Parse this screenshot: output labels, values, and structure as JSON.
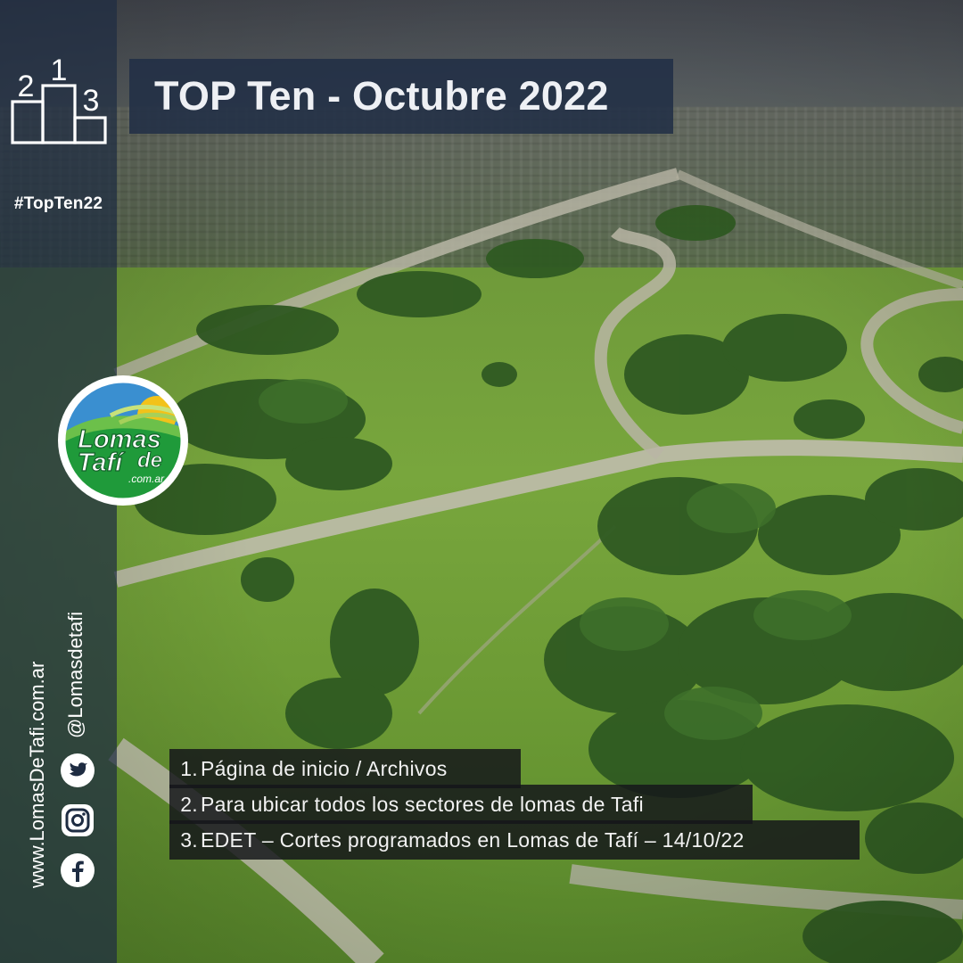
{
  "header": {
    "title": "TOP Ten - Octubre 2022",
    "hashtag": "#TopTen22"
  },
  "podium": {
    "icon": "podium-icon",
    "place_1": "1",
    "place_2": "2",
    "place_3": "3"
  },
  "logo": {
    "icon": "lomas-de-tafi-logo",
    "line1": "Lomas",
    "line2": "Tafí",
    "line2_suffix": "de",
    "domain": ".com.ar"
  },
  "contact": {
    "website": "www.LomasDeTafi.com.ar",
    "handle": "@Lomasdetafi",
    "social_icons": [
      "twitter-icon",
      "instagram-icon",
      "facebook-icon"
    ]
  },
  "ranking": [
    {
      "number": "1.",
      "label": "Página de inicio / Archivos"
    },
    {
      "number": "2.",
      "label": "Para ubicar todos los sectores de lomas de Tafi"
    },
    {
      "number": "3.",
      "label": "EDET – Cortes programados en Lomas de Tafí – 14/10/22"
    }
  ],
  "colors": {
    "sidebar": "#1e2c42",
    "title_box": "#212f46",
    "list_box": "#14161a",
    "logo_green": "#1f9a3a",
    "logo_sky": "#3a8fd0",
    "logo_sun": "#f2c21a"
  }
}
